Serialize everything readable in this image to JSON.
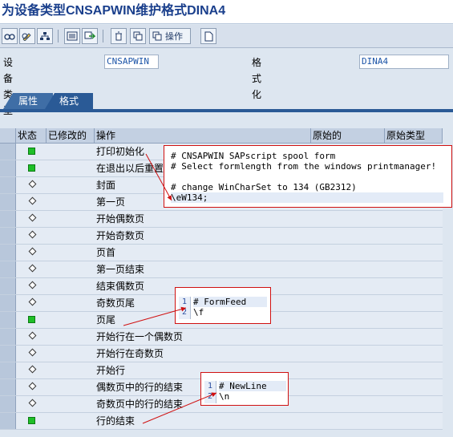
{
  "window": {
    "title": "为设备类型CNSAPWIN维护格式DINA4"
  },
  "toolbar": {
    "operation_label": "操作"
  },
  "fields": {
    "device_type_label": "设备类型",
    "device_type_value": "CNSAPWIN",
    "format_label": "格式化",
    "format_value": "DINA4"
  },
  "tabs": [
    {
      "label": "属性",
      "active": false
    },
    {
      "label": "格式",
      "active": true
    }
  ],
  "grid": {
    "columns": [
      "状态",
      "已修改的",
      "操作",
      "原始的",
      "原始类型"
    ],
    "rows": [
      {
        "status": "green",
        "op": "打印初始化"
      },
      {
        "status": "green",
        "op": "在退出以后重置"
      },
      {
        "status": "diamond",
        "op": "封面"
      },
      {
        "status": "diamond",
        "op": "第一页"
      },
      {
        "status": "diamond",
        "op": "开始偶数页"
      },
      {
        "status": "diamond",
        "op": "开始奇数页"
      },
      {
        "status": "diamond",
        "op": "页首"
      },
      {
        "status": "diamond",
        "op": "第一页结束"
      },
      {
        "status": "diamond",
        "op": "结束偶数页"
      },
      {
        "status": "diamond",
        "op": "奇数页尾"
      },
      {
        "status": "green",
        "op": "页尾"
      },
      {
        "status": "diamond",
        "op": "开始行在一个偶数页"
      },
      {
        "status": "diamond",
        "op": "开始行在奇数页"
      },
      {
        "status": "diamond",
        "op": "开始行"
      },
      {
        "status": "diamond",
        "op": "偶数页中的行的结束"
      },
      {
        "status": "diamond",
        "op": "奇数页中的行的结束"
      },
      {
        "status": "green",
        "op": "行的结束"
      }
    ]
  },
  "popups": {
    "init": {
      "lines": [
        "# CNSAPWIN SAPscript spool form",
        "# Select formlength from the windows printmanager!",
        "",
        "# change WinCharSet to 134 (GB2312)",
        "\\eW134;"
      ]
    },
    "formfeed": {
      "line_numbers": [
        "1",
        "2"
      ],
      "lines": [
        "# FormFeed",
        "\\f"
      ]
    },
    "newline": {
      "line_numbers": [
        "1",
        "2"
      ],
      "lines": [
        "# NewLine",
        "\\n"
      ]
    }
  },
  "colors": {
    "accent": "#2a5a96",
    "title": "#1a3f8c",
    "status_green": "#1fbf28",
    "callout": "#d01010"
  }
}
